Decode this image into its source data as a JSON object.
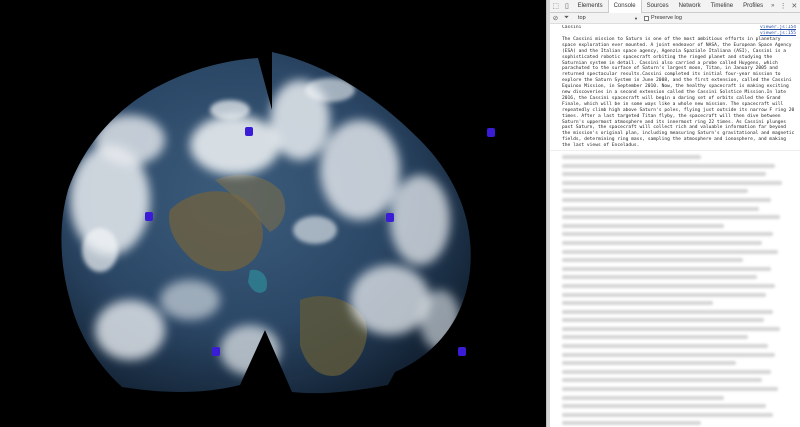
{
  "devtools": {
    "tabs": [
      {
        "label": "Elements",
        "active": false
      },
      {
        "label": "Console",
        "active": true
      },
      {
        "label": "Sources",
        "active": false
      },
      {
        "label": "Network",
        "active": false
      },
      {
        "label": "Timeline",
        "active": false
      },
      {
        "label": "Profiles",
        "active": false
      }
    ],
    "more_tabs": "»",
    "close": "✕",
    "context": {
      "label": "top",
      "arrow": "▼"
    },
    "preserve_log_label": "Preserve log",
    "icons": [
      "inspect-icon",
      "device-mode-icon",
      "vertical-dots-icon",
      "close-icon",
      "clear-console-icon",
      "filter-icon"
    ]
  },
  "console": {
    "messages": [
      {
        "label": "Cassini",
        "source": "viewer.js:154"
      },
      {
        "label": "",
        "source": "viewer.js:155",
        "text": "The Cassini mission to Saturn is one of the most ambitious efforts in planetary space exploration ever mounted. A joint endeavor of NASA, the European Space Agency (ESA) and the Italian space agency, Agenzia Spaziale Italiana (ASI), Cassini is a sophisticated robotic spacecraft orbiting the ringed planet and studying the Saturnian system in detail. Cassini also carried a probe called Huygens, which parachuted to the surface of Saturn's largest moon, Titan, in January 2005 and returned spectacular results.Cassini completed its initial four-year mission to explore the Saturn System in June 2008, and the first extension, called the Cassini Equinox Mission, in September 2010. Now, the healthy spacecraft is making exciting new discoveries in a second extension called the Cassini Solstice Mission.In late 2016, the Cassini spacecraft will begin a daring set of orbits called the Grand Finale, which will be in some ways like a whole new mission. The spacecraft will repeatedly climb high above Saturn's poles, flying just outside its narrow F ring 20 times. After a last targeted Titan flyby, the spacecraft will then dive between Saturn's uppermost atmosphere and its innermost ring 22 times. As Cassini plunges past Saturn, the spacecraft will collect rich and valuable information far beyond the mission's original plan, including measuring Saturn's gravitational and magnetic fields, determining ring mass, sampling the atmosphere and ionosphere, and making the last views of Enceladus."
      }
    ]
  },
  "viewer": {
    "markers": [
      {
        "name": "marker-1"
      },
      {
        "name": "marker-2"
      },
      {
        "name": "marker-3"
      },
      {
        "name": "marker-4"
      },
      {
        "name": "marker-5"
      },
      {
        "name": "marker-6"
      }
    ],
    "marker_color": "#3a1cd6"
  },
  "colors": {
    "ocean": "#25405e",
    "cloud": "#e8ecf0",
    "land": "#6b6045",
    "devtools_bg": "#f3f3f3",
    "link": "#2a52a8"
  }
}
